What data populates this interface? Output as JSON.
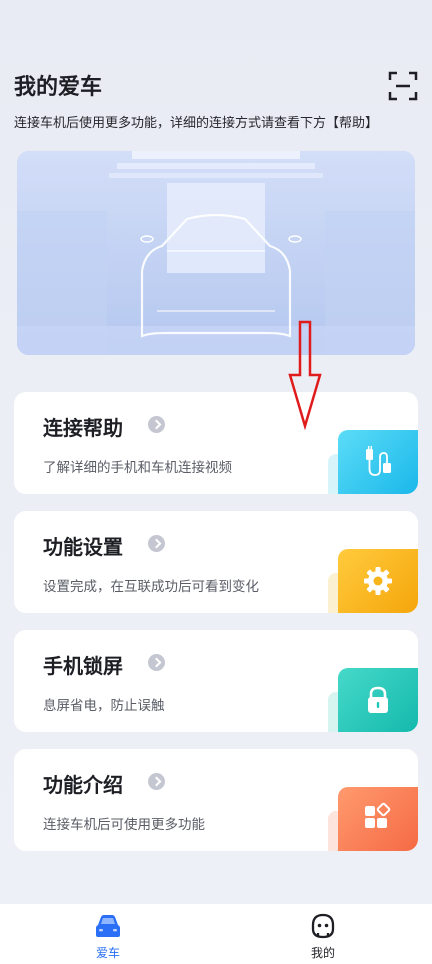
{
  "header": {
    "title": "我的爱车",
    "scan_icon": "scan-icon"
  },
  "subtitle": "连接车机后使用更多功能，详细的连接方式请查看下方【帮助】",
  "cards": [
    {
      "title": "连接帮助",
      "desc": "了解详细的手机和车机连接视频",
      "icon": "usb-cable-icon",
      "accent": "#2ec6ef"
    },
    {
      "title": "功能设置",
      "desc": "设置完成，在互联成功后可看到变化",
      "icon": "gear-icon",
      "accent": "#f7b51c"
    },
    {
      "title": "手机锁屏",
      "desc": "息屏省电，防止误触",
      "icon": "lock-icon",
      "accent": "#1fc7bb"
    },
    {
      "title": "功能介绍",
      "desc": "连接车机后可使用更多功能",
      "icon": "apps-icon",
      "accent": "#fa7d58"
    }
  ],
  "tabbar": {
    "tabs": [
      {
        "label": "爱车",
        "icon": "car-icon",
        "active": true,
        "color": "#2a6ff5"
      },
      {
        "label": "我的",
        "icon": "profile-icon",
        "active": false,
        "color": "#1e1f24"
      }
    ]
  },
  "annotation": {
    "icon": "red-down-arrow-icon",
    "color": "#e01b1b"
  }
}
